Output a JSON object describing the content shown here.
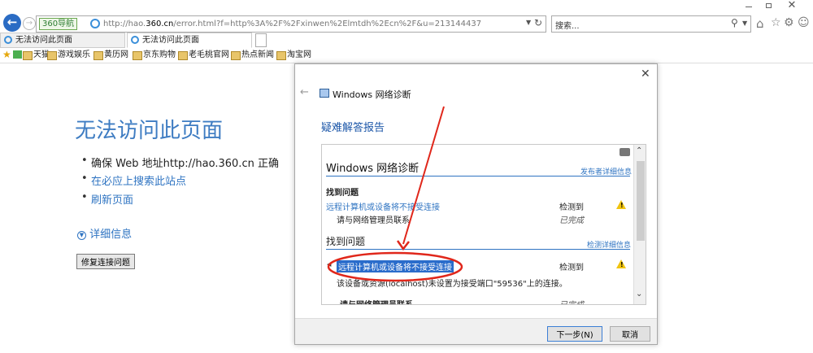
{
  "browser": {
    "address_url": "http://hao.360.cn/error.html?f=http%3A%2F%2Fxinwen%2Elmtdh%2Ecn%2F&u=213144437",
    "address_prefix": "http://hao.",
    "address_domain": "360.cn",
    "address_suffix": "/error.html?f=http%3A%2F%2Fxinwen%2Elmtdh%2Ecn%2F&u=213144437",
    "nav_label": "360导航",
    "search_placeholder": "搜索...",
    "tabs": [
      {
        "label": "无法访问此页面"
      },
      {
        "label": "无法访问此页面"
      }
    ],
    "favorites": [
      {
        "label": "天猫"
      },
      {
        "label": "游戏娱乐"
      },
      {
        "label": "黄历网"
      },
      {
        "label": "京东购物"
      },
      {
        "label": "老毛桃官网"
      },
      {
        "label": "热点新闻"
      },
      {
        "label": "淘宝网"
      }
    ]
  },
  "errorpage": {
    "title": "无法访问此页面",
    "items": [
      {
        "text": "确保 Web 地址http://hao.360.cn 正确"
      },
      {
        "text": "在必应上搜索此站点"
      },
      {
        "text": "刷新页面"
      }
    ],
    "details": "详细信息",
    "repair_button": "修复连接问题"
  },
  "dialog": {
    "app_title": "Windows 网络诊断",
    "heading": "疑难解答报告",
    "report_title": "Windows 网络诊断",
    "publisher_link": "发布者详细信息",
    "section1_heading": "找到问题",
    "issue1_link": "远程计算机或设备将不接受连接",
    "issue1_status": "检测到",
    "issue1_sub": "请与网络管理员联系",
    "issue1_sub_status": "已完成",
    "section2_heading": "找到问题",
    "detail_link": "检测详细信息",
    "issue2_label": "远程计算机或设备将不接受连接",
    "issue2_status": "检测到",
    "issue2_desc": "该设备或资源(localhost)未设置为接受端口\"59536\"上的连接。",
    "issue2_sub": "请与网络管理员联系",
    "issue2_sub_status": "已完成",
    "next_button": "下一步(N)",
    "cancel_button": "取消"
  },
  "colors": {
    "accent": "#3e7cc2",
    "link": "#2f74c2",
    "annotation": "#e0271b",
    "warning": "#f1c40f"
  }
}
